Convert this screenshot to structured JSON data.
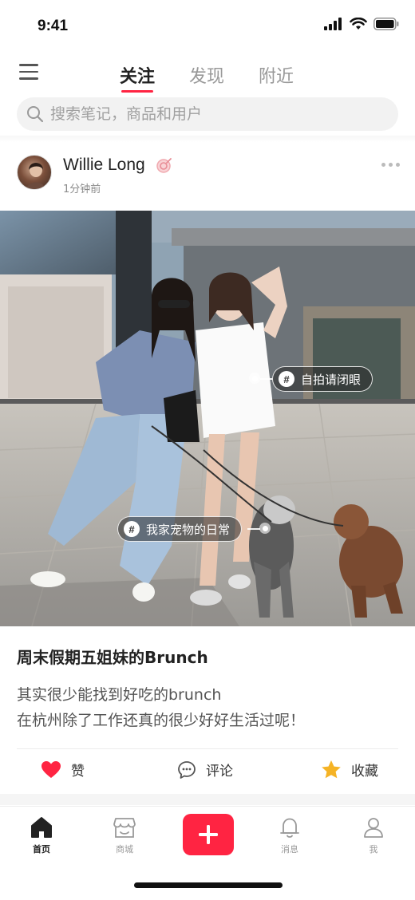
{
  "status": {
    "time": "9:41"
  },
  "nav": {
    "tabs": [
      {
        "label": "关注",
        "active": true
      },
      {
        "label": "发现",
        "active": false
      },
      {
        "label": "附近",
        "active": false
      }
    ]
  },
  "search": {
    "placeholder": "搜索笔记，商品和用户"
  },
  "post": {
    "username": "Willie Long",
    "time": "1分钟前",
    "tags": [
      "自拍请闭眼",
      "我家宠物的日常"
    ],
    "title": "周末假期五姐妹的Brunch",
    "body": [
      "其实很少能找到好吃的brunch",
      "在杭州除了工作还真的很少好好生活过呢！"
    ]
  },
  "actions": {
    "like": "赞",
    "comment": "评论",
    "collect": "收藏"
  },
  "tabbar": {
    "items": [
      {
        "label": "首页",
        "icon": "home-icon",
        "active": true
      },
      {
        "label": "商城",
        "icon": "shop-icon",
        "active": false
      },
      {
        "label": "消息",
        "icon": "bell-icon",
        "active": false
      },
      {
        "label": "我",
        "icon": "user-icon",
        "active": false
      }
    ]
  },
  "colors": {
    "accent": "#ff2442",
    "star": "#f5b325"
  }
}
